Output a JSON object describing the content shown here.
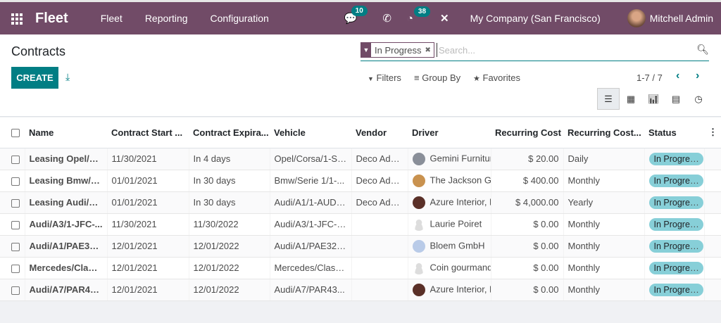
{
  "nav": {
    "app": "Fleet",
    "menus": [
      "Fleet",
      "Reporting",
      "Configuration"
    ],
    "messages_count": "10",
    "activities_count": "38",
    "company": "My Company (San Francisco)",
    "user": "Mitchell Admin"
  },
  "colors": {
    "brand": "#714b67",
    "accent": "#017e84",
    "status_pill": "#87cfd8"
  },
  "page": {
    "title": "Contracts",
    "create": "CREATE",
    "download_icon": "download-icon"
  },
  "search": {
    "facet": "In Progress",
    "placeholder": "Search..."
  },
  "filters": {
    "filters": "Filters",
    "group_by": "Group By",
    "favorites": "Favorites"
  },
  "pager": "1-7 / 7",
  "views": [
    "list",
    "kanban",
    "graph",
    "pivot",
    "activity"
  ],
  "table": {
    "columns": [
      "Name",
      "Contract Start ...",
      "Contract Expira...",
      "Vehicle",
      "Vendor",
      "Driver",
      "Recurring Cost",
      "Recurring Cost...",
      "Status"
    ],
    "rows": [
      {
        "name": "Leasing Opel/Co...",
        "start": "11/30/2021",
        "exp": "In 4 days",
        "vehicle": "Opel/Corsa/1-SY...",
        "vendor": "Deco Addict",
        "driver": "Gemini Furniture",
        "avatar": "#8a8f99",
        "cost": "$ 20.00",
        "freq": "Daily",
        "status": "In Progress"
      },
      {
        "name": "Leasing Bmw/Se...",
        "start": "01/01/2021",
        "exp": "In 30 days",
        "vehicle": "Bmw/Serie 1/1-...",
        "vendor": "Deco Addict",
        "driver": "The Jackson Group",
        "avatar": "#c9924f",
        "cost": "$ 400.00",
        "freq": "Monthly",
        "status": "In Progress"
      },
      {
        "name": "Leasing Audi/A1...",
        "start": "01/01/2021",
        "exp": "In 30 days",
        "vehicle": "Audi/A1/1-AUD-...",
        "vendor": "Deco Addict",
        "driver": "Azure Interior, Brandon Freeman",
        "avatar": "#5a3028",
        "cost": "$ 4,000.00",
        "freq": "Yearly",
        "status": "In Progress"
      },
      {
        "name": "Audi/A3/1-JFC-...",
        "start": "11/30/2021",
        "exp": "11/30/2022",
        "vehicle": "Audi/A3/1-JFC-0...",
        "vendor": "",
        "driver": "Laurie Poiret",
        "avatar": "placeholder",
        "cost": "$ 0.00",
        "freq": "Monthly",
        "status": "In Progress"
      },
      {
        "name": "Audi/A1/PAE324...",
        "start": "12/01/2021",
        "exp": "12/01/2022",
        "vehicle": "Audi/A1/PAE324...",
        "vendor": "",
        "driver": "Bloem GmbH",
        "avatar": "#b9cbe8",
        "cost": "$ 0.00",
        "freq": "Monthly",
        "status": "In Progress"
      },
      {
        "name": "Mercedes/Class ...",
        "start": "12/01/2021",
        "exp": "12/01/2022",
        "vehicle": "Mercedes/Class ...",
        "vendor": "",
        "driver": "Coin gourmand",
        "avatar": "placeholder",
        "cost": "$ 0.00",
        "freq": "Monthly",
        "status": "In Progress"
      },
      {
        "name": "Audi/A7/PAR43...",
        "start": "12/01/2021",
        "exp": "12/01/2022",
        "vehicle": "Audi/A7/PAR43...",
        "vendor": "",
        "driver": "Azure Interior, Brandon Freeman",
        "avatar": "#5a3028",
        "cost": "$ 0.00",
        "freq": "Monthly",
        "status": "In Progress"
      }
    ]
  }
}
